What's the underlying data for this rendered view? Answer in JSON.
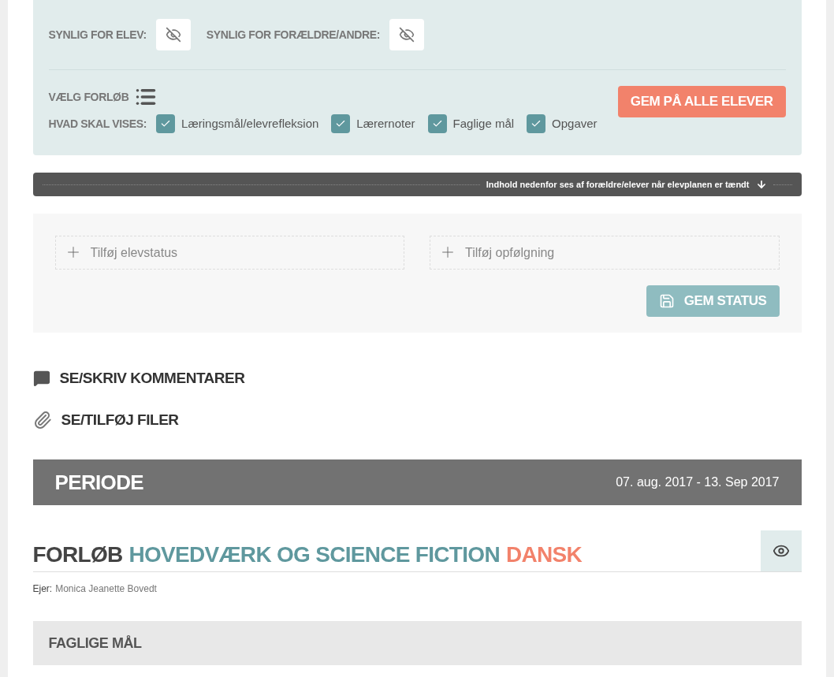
{
  "visibility": [
    {
      "label": "SYNLIG FOR ELEV:",
      "visible": false
    },
    {
      "label": "SYNLIG FOR FORÆLDRE/ANDRE:",
      "visible": false
    }
  ],
  "choose_course": {
    "label": "VÆLG FORLØB"
  },
  "save_all_button": "GEM PÅ ALLE ELEVER",
  "show_options": {
    "label": "HVAD SKAL VISES:",
    "items": [
      {
        "label": "Læringsmål/elevrefleksion",
        "checked": true
      },
      {
        "label": "Lærernoter",
        "checked": true
      },
      {
        "label": "Faglige mål",
        "checked": true
      },
      {
        "label": "Opgaver",
        "checked": true
      }
    ]
  },
  "notice_bar": "Indhold nedenfor ses af forældre/elever når elevplanen er tændt",
  "status": {
    "fields": [
      {
        "placeholder": "Tilføj elevstatus"
      },
      {
        "placeholder": "Tilføj opfølgning"
      }
    ],
    "save_button": "GEM STATUS"
  },
  "links": [
    {
      "kind": "comments",
      "label": "SE/SKRIV KOMMENTARER"
    },
    {
      "kind": "files",
      "label": "SE/TILFØJ FILER"
    }
  ],
  "period": {
    "title": "PERIODE",
    "dates": "07. aug. 2017 - 13. Sep 2017"
  },
  "course": {
    "prefix": "FORLØB",
    "name": "HOVEDVÆRK OG SCIENCE FICTION",
    "subject": "DANSK",
    "owner_label": "Ejer:",
    "owner": "Monica Jeanette Bovedt",
    "visible": true
  },
  "section": {
    "title": "FAGLIGE MÅL"
  }
}
